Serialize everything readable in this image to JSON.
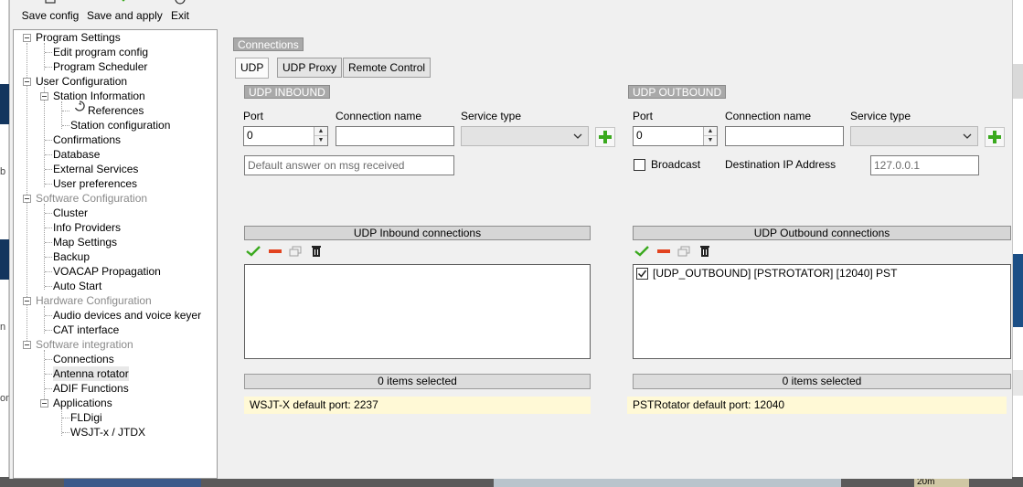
{
  "toolbar": {
    "save_config": "Save config",
    "save_and_apply": "Save and apply",
    "exit": "Exit"
  },
  "tree": {
    "program_settings": "Program Settings",
    "edit_program_config": "Edit program config",
    "program_scheduler": "Program Scheduler",
    "user_configuration": "User Configuration",
    "station_information": "Station Information",
    "references": "References",
    "station_configuration": "Station configuration",
    "confirmations": "Confirmations",
    "database": "Database",
    "external_services": "External Services",
    "user_preferences": "User preferences",
    "software_configuration": "Software Configuration",
    "cluster": "Cluster",
    "info_providers": "Info Providers",
    "map_settings": "Map Settings",
    "backup": "Backup",
    "voacap_propagation": "VOACAP Propagation",
    "auto_start": "Auto Start",
    "hardware_configuration": "Hardware Configuration",
    "audio_devices": "Audio devices and voice keyer",
    "cat_interface": "CAT interface",
    "software_integration": "Software integration",
    "connections": "Connections",
    "antenna_rotator": "Antenna rotator",
    "adif_functions": "ADIF Functions",
    "applications": "Applications",
    "fldigi": "FLDigi",
    "wsjtx_jtdx": "WSJT-x / JTDX"
  },
  "panel": {
    "title": "Connections",
    "tabs": [
      "UDP",
      "UDP Proxy",
      "Remote Control"
    ]
  },
  "inbound": {
    "group_title": "UDP INBOUND",
    "port_label": "Port",
    "port_value": "0",
    "connection_name_label": "Connection name",
    "connection_name_value": "",
    "service_type_label": "Service type",
    "service_type_value": "",
    "default_answer_placeholder": "Default answer on msg received",
    "list_title": "UDP Inbound connections",
    "items": [],
    "status": "0 items selected",
    "note": "WSJT-X default port: 2237"
  },
  "outbound": {
    "group_title": "UDP OUTBOUND",
    "port_label": "Port",
    "port_value": "0",
    "connection_name_label": "Connection name",
    "connection_name_value": "",
    "service_type_label": "Service type",
    "service_type_value": "",
    "broadcast_label": "Broadcast",
    "broadcast_checked": false,
    "dest_ip_label": "Destination IP Address",
    "dest_ip_placeholder": "127.0.0.1",
    "list_title": "UDP Outbound connections",
    "items": [
      {
        "checked": true,
        "text": "[UDP_OUTBOUND] [PSTROTATOR] [12040] PST"
      }
    ],
    "status": "0 items selected",
    "note": "PSTRotator default port: 12040"
  },
  "background": {
    "left_chars": [
      "b",
      "n",
      "on"
    ],
    "bottom_texts": [
      "20m"
    ]
  },
  "colors": {
    "accent_green": "#3aa91e",
    "remove_red": "#e2431f",
    "note_bg": "#fff9d6",
    "group_tag_bg": "#a9a9a9"
  }
}
